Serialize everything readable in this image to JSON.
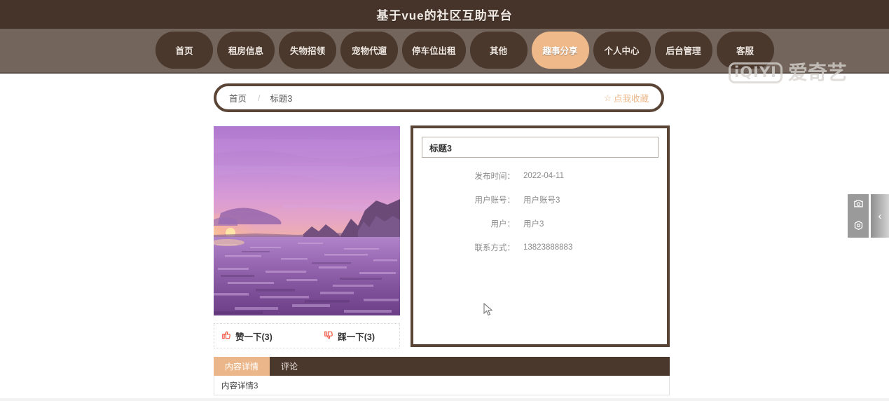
{
  "header": {
    "site_title": "基于vue的社区互助平台",
    "bg_color": "#46342a",
    "nav_bg_color": "#73655c"
  },
  "nav": {
    "items": [
      {
        "label": "首页",
        "active": false
      },
      {
        "label": "租房信息",
        "active": false
      },
      {
        "label": "失物招领",
        "active": false
      },
      {
        "label": "宠物代遛",
        "active": false
      },
      {
        "label": "停车位出租",
        "active": false
      },
      {
        "label": "其他",
        "active": false
      },
      {
        "label": "趣事分享",
        "active": true
      },
      {
        "label": "个人中心",
        "active": false
      },
      {
        "label": "后台管理",
        "active": false
      },
      {
        "label": "客服",
        "active": false
      }
    ],
    "active_color": "#efb98a",
    "item_color": "#4b382c"
  },
  "watermark": {
    "mark_text": "iQIYI",
    "cn_text": "爱奇艺"
  },
  "breadcrumb": {
    "home": "首页",
    "separator": "/",
    "current": "标题3",
    "favorite_icon": "☆",
    "favorite_label": "点我收藏",
    "favorite_color": "#edb98b"
  },
  "detail": {
    "title": "标题3",
    "fields": [
      {
        "label": "发布时间：",
        "value": "2022-04-11"
      },
      {
        "label": "用户账号：",
        "value": "用户账号3"
      },
      {
        "label": "用户：",
        "value": "用户3"
      },
      {
        "label": "联系方式：",
        "value": "13823888883"
      }
    ]
  },
  "votes": {
    "like_icon": "👍",
    "like_label": "赞一下(3)",
    "dislike_icon": "👎",
    "dislike_label": "踩一下(3)",
    "icon_color": "#f1503c"
  },
  "tabs": {
    "items": [
      {
        "label": "内容详情",
        "active": true
      },
      {
        "label": "评论",
        "active": false
      }
    ],
    "content": "内容详情3",
    "active_color": "#eab68a",
    "bar_color": "#4b382c"
  },
  "float_toolbar": {
    "camera_icon": "camera-icon",
    "settings_icon": "settings-icon",
    "collapse_icon": "‹"
  },
  "photo": {
    "alt": "紫色日落海景照片"
  }
}
